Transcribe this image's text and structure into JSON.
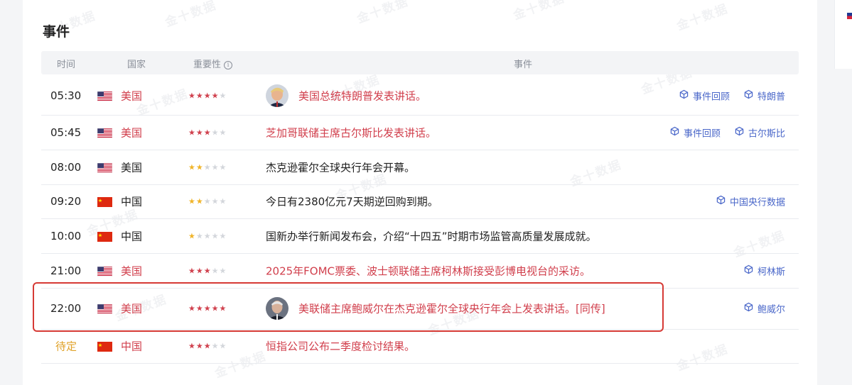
{
  "section_title": "事件",
  "watermark_text": "金十数据",
  "table_header": {
    "time": "时间",
    "country": "国家",
    "importance": "重要性",
    "event": "事件"
  },
  "rows": [
    {
      "time": "05:30",
      "country": "美国",
      "flag": "us",
      "stars": 4,
      "star_color": "red",
      "event": "美国总统特朗普发表讲话。",
      "event_color": "red",
      "avatar": "trump",
      "links": [
        "事件回顾",
        "特朗普"
      ]
    },
    {
      "time": "05:45",
      "country": "美国",
      "flag": "us",
      "stars": 3,
      "star_color": "red",
      "event": "芝加哥联储主席古尔斯比发表讲话。",
      "event_color": "red",
      "avatar": null,
      "links": [
        "事件回顾",
        "古尔斯比"
      ]
    },
    {
      "time": "08:00",
      "country": "美国",
      "flag": "us",
      "stars": 2,
      "star_color": "gold",
      "event": "杰克逊霍尔全球央行年会开幕。",
      "event_color": "dark",
      "avatar": null,
      "links": []
    },
    {
      "time": "09:20",
      "country": "中国",
      "flag": "cn",
      "stars": 2,
      "star_color": "gold",
      "event": "今日有2380亿元7天期逆回购到期。",
      "event_color": "dark",
      "avatar": null,
      "links": [
        "中国央行数据"
      ]
    },
    {
      "time": "10:00",
      "country": "中国",
      "flag": "cn",
      "stars": 1,
      "star_color": "gold",
      "event": "国新办举行新闻发布会，介绍“十四五”时期市场监管高质量发展成就。",
      "event_color": "dark",
      "avatar": null,
      "links": []
    },
    {
      "time": "21:00",
      "country": "美国",
      "flag": "us",
      "stars": 3,
      "star_color": "red",
      "event": "2025年FOMC票委、波士顿联储主席柯林斯接受彭博电视台的采访。",
      "event_color": "red",
      "avatar": null,
      "links": [
        "柯林斯"
      ]
    },
    {
      "time": "22:00",
      "country": "美国",
      "flag": "us",
      "stars": 5,
      "star_color": "red",
      "event": "美联储主席鲍威尔在杰克逊霍尔全球央行年会上发表讲话。[同传]",
      "event_color": "red",
      "avatar": "powell",
      "links": [
        "鲍威尔"
      ]
    },
    {
      "time": "待定",
      "country": "中国",
      "flag": "cn",
      "stars": 3,
      "star_color": "red",
      "event": "恒指公司公布二季度检讨结果。",
      "event_color": "red",
      "avatar": null,
      "links": []
    }
  ],
  "colors": {
    "accent_red": "#d13f4c",
    "link_blue": "#4a67c9",
    "star_gold": "#f0b429",
    "pending_orange": "#e0a228",
    "highlight_border": "#d63a35"
  }
}
